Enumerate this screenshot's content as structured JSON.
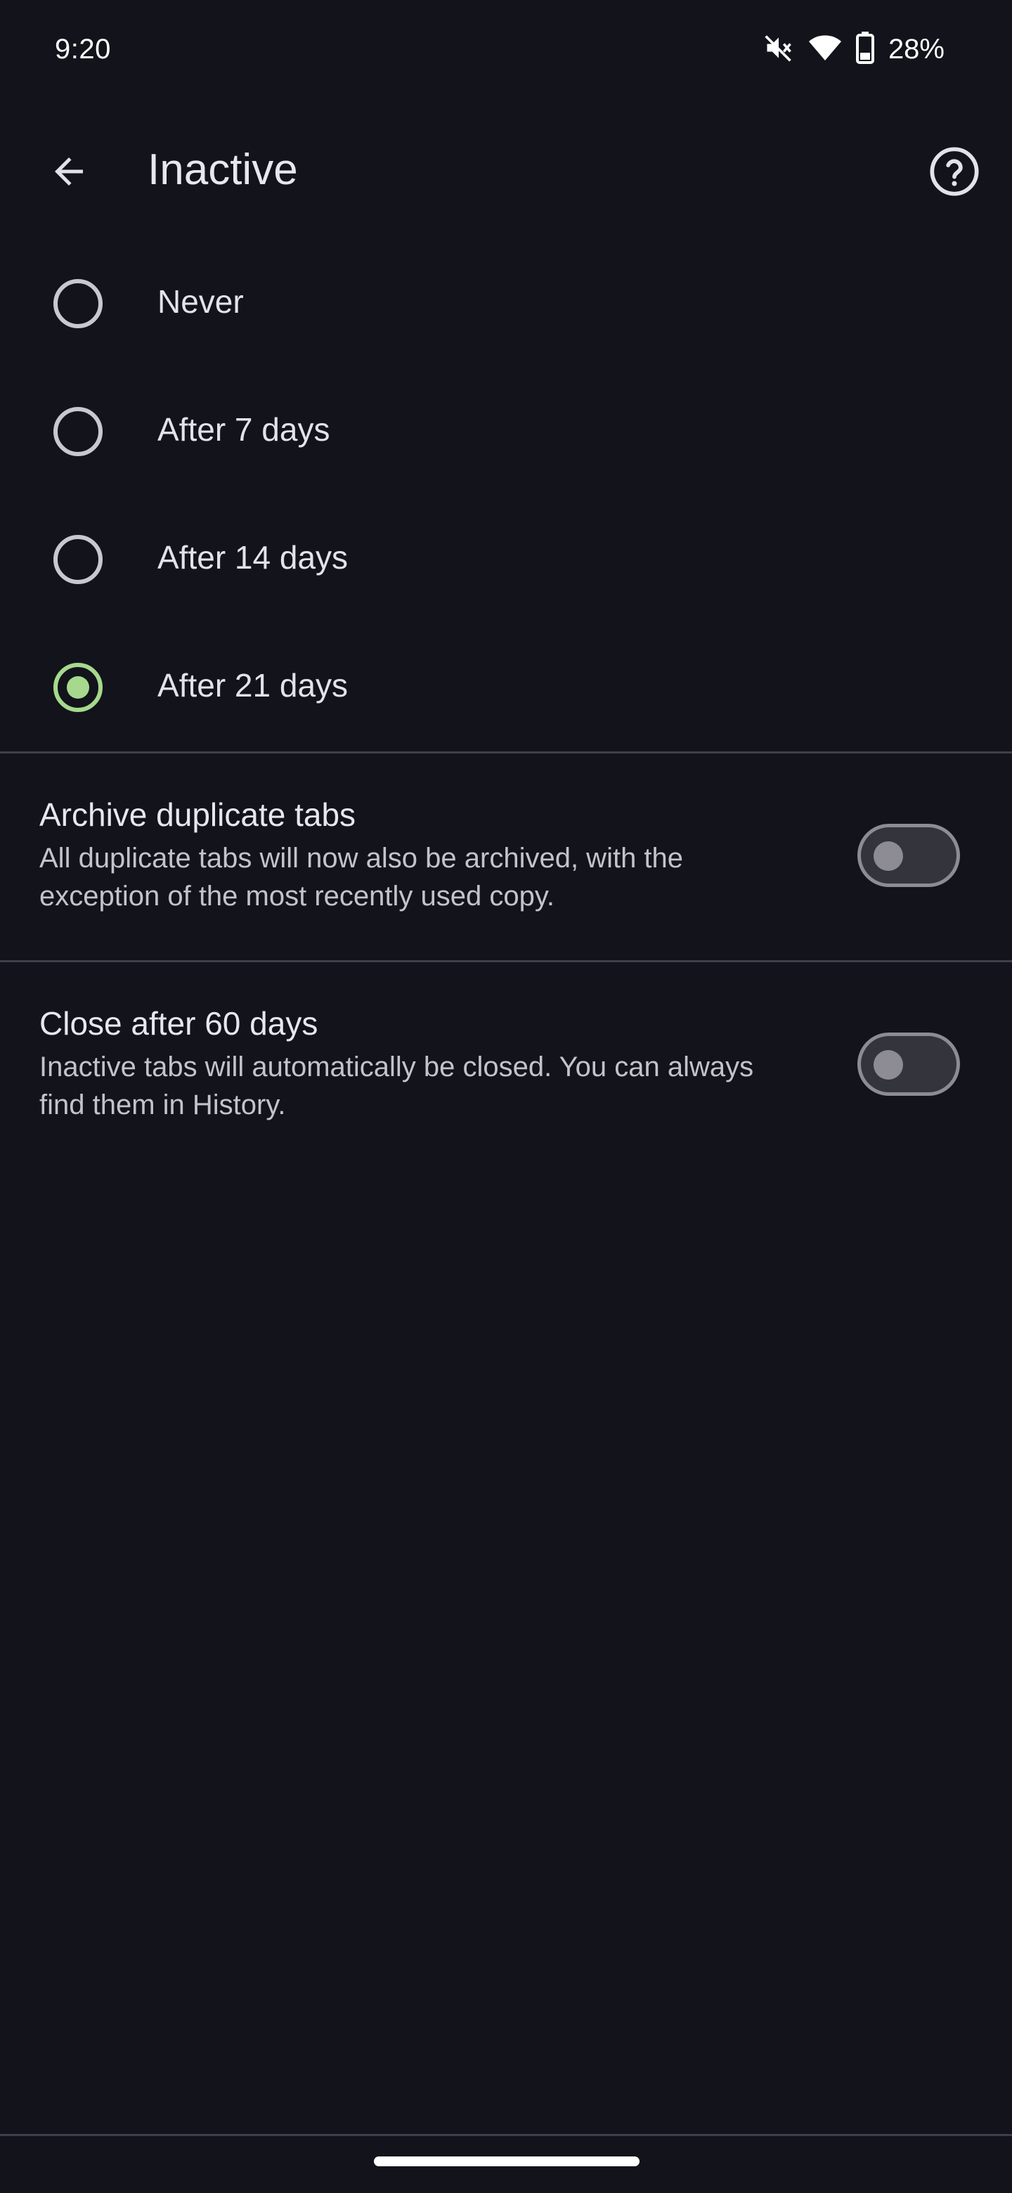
{
  "status_bar": {
    "time": "9:20",
    "battery_percent": "28%",
    "icons": [
      "mute-icon",
      "wifi-icon",
      "battery-icon"
    ]
  },
  "app_bar": {
    "title": "Inactive",
    "back_icon": "arrow-back-icon",
    "help_icon": "help-icon"
  },
  "radio_options": [
    {
      "label": "Never",
      "selected": false
    },
    {
      "label": "After 7 days",
      "selected": false
    },
    {
      "label": "After 14 days",
      "selected": false
    },
    {
      "label": "After 21 days",
      "selected": true
    }
  ],
  "settings": [
    {
      "title": "Archive duplicate tabs",
      "description": "All duplicate tabs will now also be archived, with the exception of the most recently used copy.",
      "enabled": false
    },
    {
      "title": "Close after 60 days",
      "description": "Inactive tabs will automatically be closed. You can always find them in History.",
      "enabled": false
    }
  ],
  "colors": {
    "background": "#12131b",
    "accent": "#a6d98d",
    "divider": "#3e3f48"
  }
}
